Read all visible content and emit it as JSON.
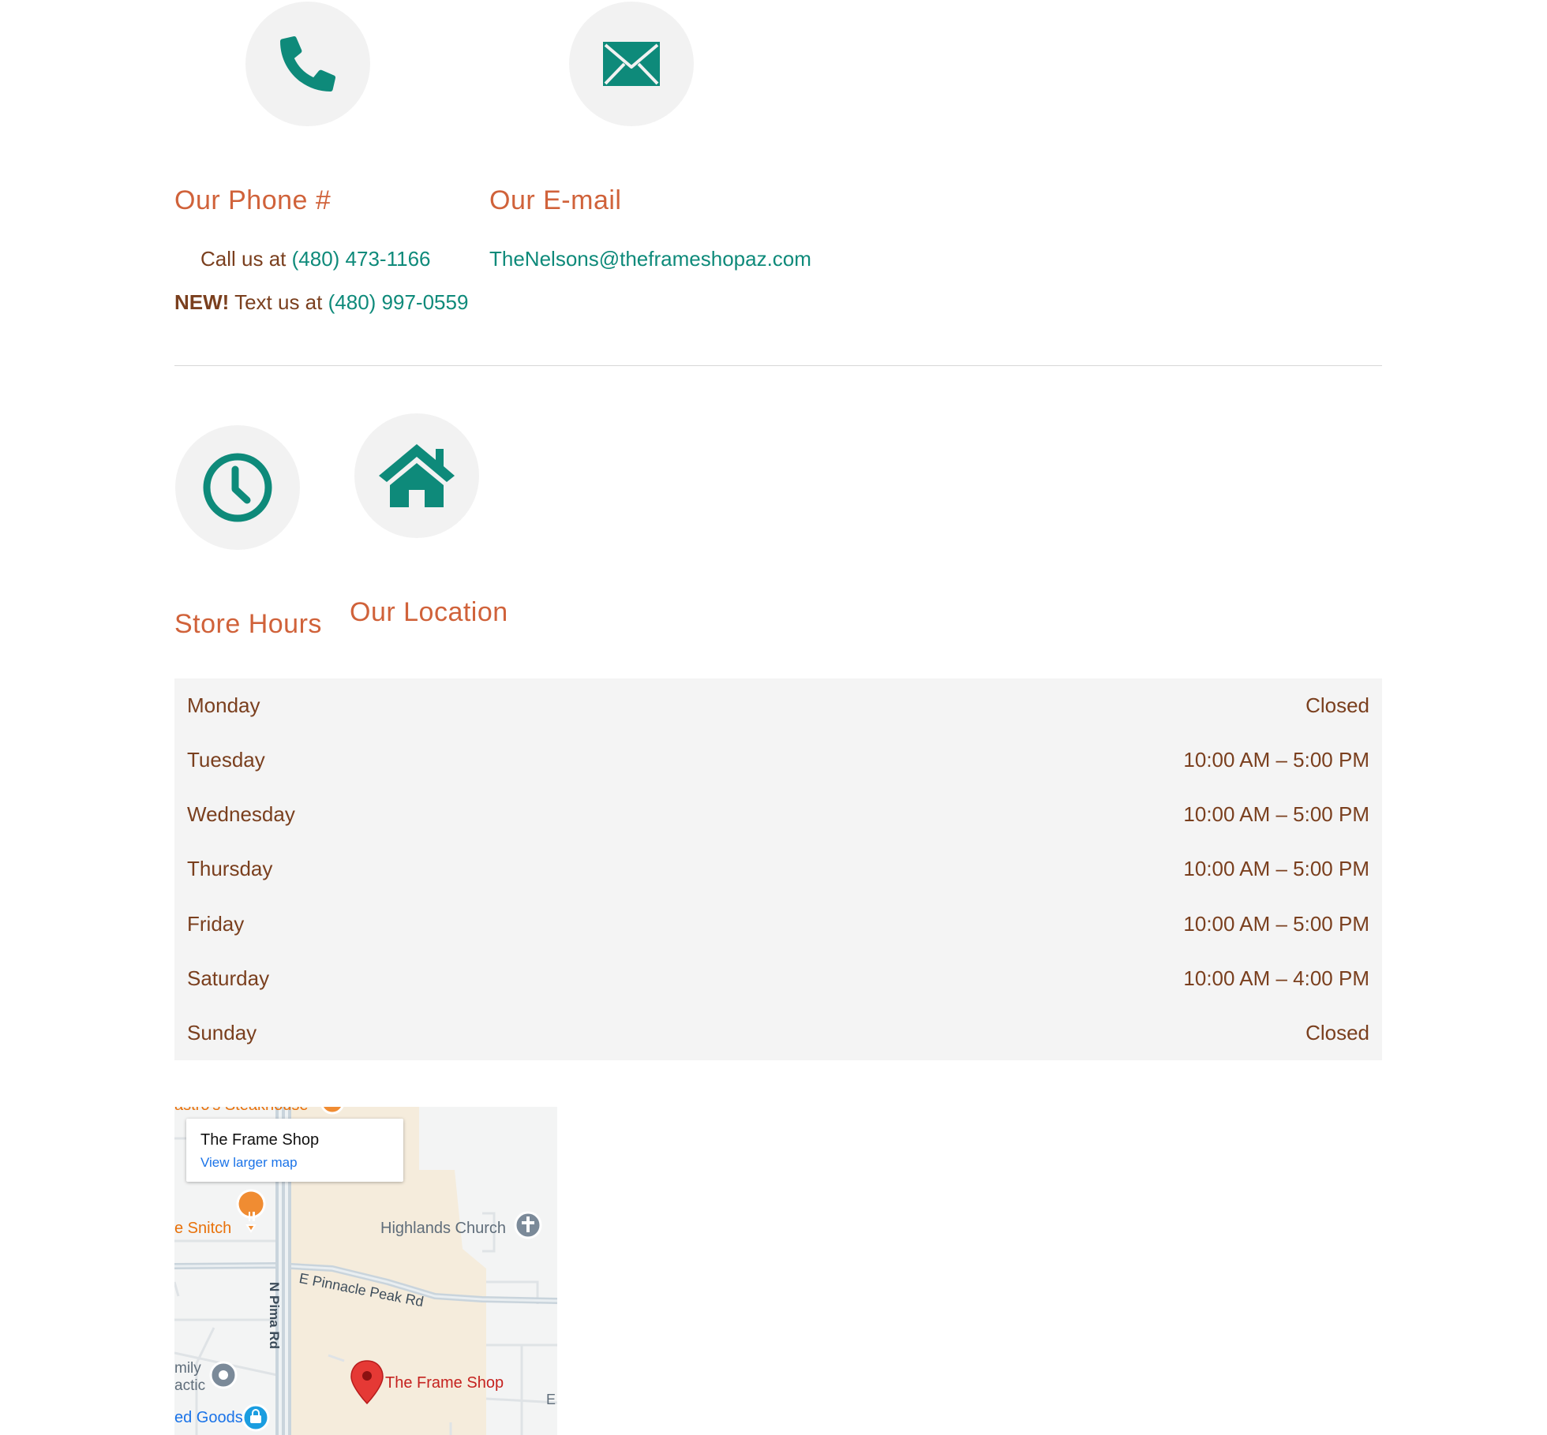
{
  "contact": {
    "phone": {
      "icon": "phone-icon",
      "heading": "Our Phone #",
      "call_prefix": "Call us at",
      "call_number": "(480) 473-1166",
      "new_badge": "NEW!",
      "text_prefix": "Text us at",
      "text_number": "(480) 997-0559"
    },
    "email": {
      "icon": "envelope-icon",
      "heading": "Our E-mail",
      "address": "TheNelsons@theframeshopaz.com"
    }
  },
  "hours": {
    "icon": "clock-icon",
    "heading": "Store Hours",
    "rows": [
      {
        "day": "Monday",
        "time": "Closed"
      },
      {
        "day": "Tuesday",
        "time": "10:00 AM – 5:00 PM"
      },
      {
        "day": "Wednesday",
        "time": "10:00 AM – 5:00 PM"
      },
      {
        "day": "Thursday",
        "time": "10:00 AM – 5:00 PM"
      },
      {
        "day": "Friday",
        "time": "10:00 AM – 5:00 PM"
      },
      {
        "day": "Saturday",
        "time": "10:00 AM – 4:00 PM"
      },
      {
        "day": "Sunday",
        "time": "Closed"
      }
    ]
  },
  "location": {
    "icon": "home-icon",
    "heading": "Our Location"
  },
  "map": {
    "card_title": "The Frame Shop",
    "card_link": "View larger map",
    "labels": {
      "steakhouse": "astro's Steakhouse",
      "snitch": "e Snitch",
      "church": "Highlands Church",
      "road_pinnacle": "E Pinnacle Peak Rd",
      "road_pima": "N Pima Rd",
      "family_1": "mily",
      "family_2": "actic",
      "goods": "ed Goods",
      "pin": "The Frame Shop",
      "edge_e": "E"
    }
  },
  "colors": {
    "accent_teal": "#0e8a7a",
    "heading_orange": "#d0623a",
    "text_brown": "#7a3f1e",
    "icon_bg": "#f2f2f2"
  }
}
